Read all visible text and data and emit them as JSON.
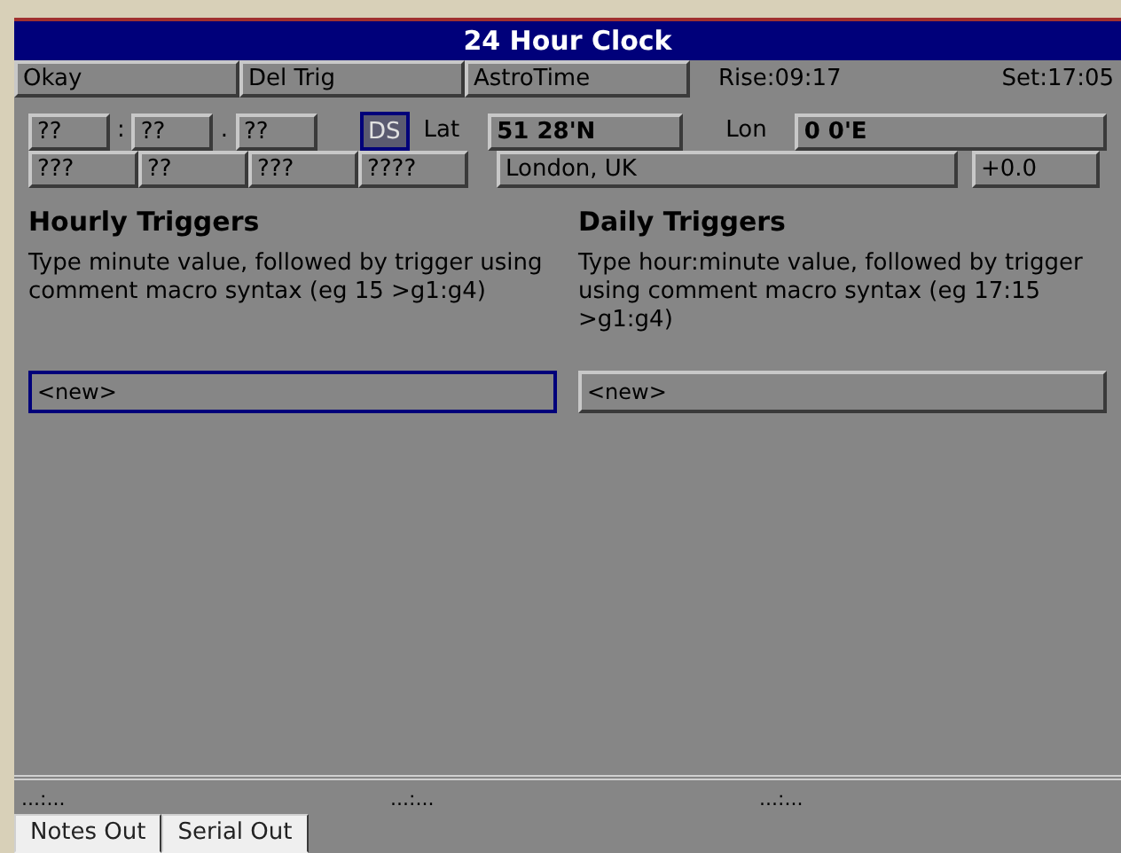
{
  "window": {
    "title": "24 Hour Clock"
  },
  "toolbar": {
    "buttons": [
      "Okay",
      "Del Trig",
      "AstroTime"
    ],
    "rise": "Rise:09:17",
    "set": "Set:17:05"
  },
  "time_row": {
    "fields": [
      {
        "value": "??",
        "sep": ":"
      },
      {
        "value": "??",
        "sep": "."
      },
      {
        "value": "??"
      }
    ],
    "ds": {
      "label": "DS",
      "selected": true
    },
    "lat_label": "Lat",
    "lat": "51 28'N",
    "lon_label": "Lon",
    "lon": "0 0'E"
  },
  "date_row": {
    "fields": [
      "???",
      "??",
      "???",
      "????"
    ],
    "location": "London, UK",
    "offset": "+0.0"
  },
  "sections": [
    {
      "title": "Hourly Triggers",
      "help": "Type minute value, followed by trigger using comment macro syntax (eg 15 >g1:g4)",
      "entry": {
        "value": "<new>",
        "focused": true
      }
    },
    {
      "title": "Daily Triggers",
      "help": "Type hour:minute value, followed by trigger using comment macro syntax (eg 17:15 >g1:g4)",
      "entry": {
        "value": "<new>",
        "focused": false
      }
    }
  ],
  "status_bar": [
    "...:...",
    "...:...",
    "...:..."
  ],
  "tabs": [
    {
      "label": "Notes Out"
    },
    {
      "label": "Serial Out"
    }
  ]
}
